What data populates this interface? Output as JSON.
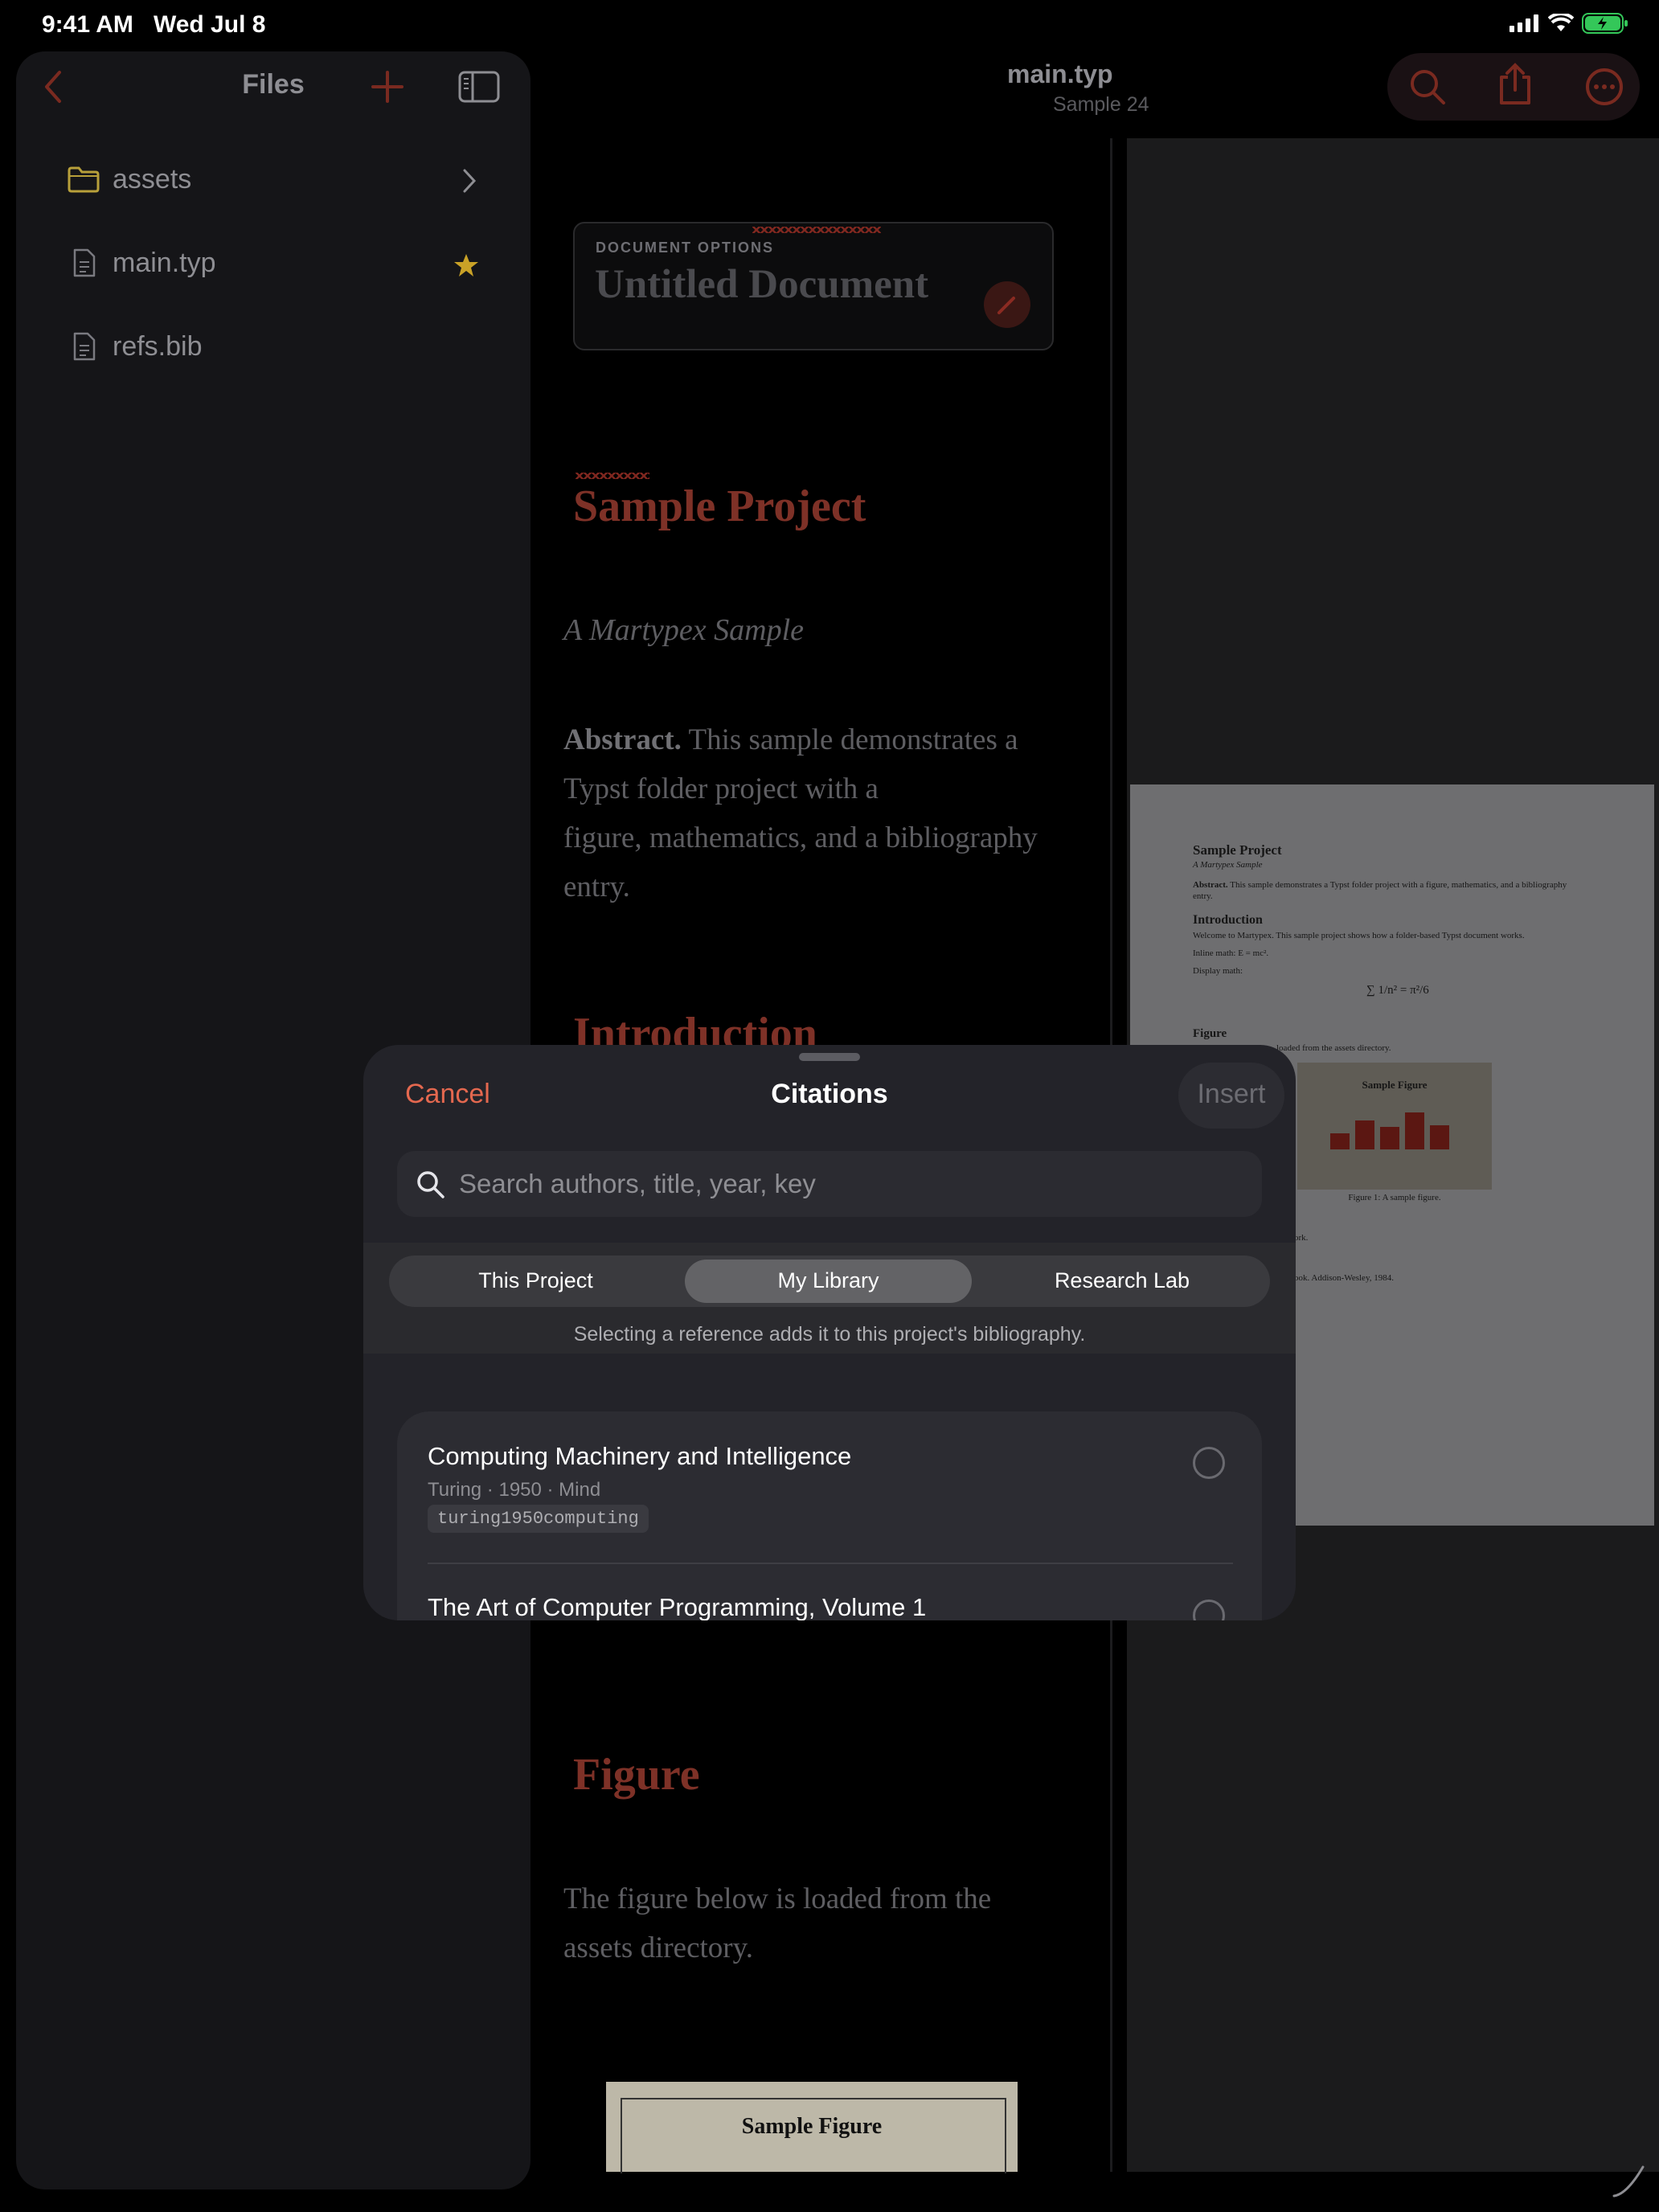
{
  "status": {
    "time": "9:41 AM",
    "date": "Wed Jul 8"
  },
  "header": {
    "title": "main.typ",
    "subtitle": "Sample 24"
  },
  "sidebar": {
    "title": "Files",
    "items": [
      {
        "label": "assets",
        "icon": "folder-icon",
        "trailing": "chevron-right-icon"
      },
      {
        "label": "main.typ",
        "icon": "document-icon",
        "trailing": "star-icon"
      },
      {
        "label": "refs.bib",
        "icon": "document-icon"
      }
    ]
  },
  "editor": {
    "options_label": "DOCUMENT OPTIONS",
    "options_title": "Untitled Document",
    "heading_project": "Sample Project",
    "subtitle": "A Martypex Sample",
    "abstract_label": "Abstract.",
    "abstract_line1": "This sample demonstrates a",
    "abstract_line2": "Typst folder project with a",
    "abstract_line3": "figure, mathematics, and a bibliography",
    "abstract_line4": "entry.",
    "heading_intro": "Introduction",
    "heading_figure": "Figure",
    "figure_line1": "The figure below is loaded from the",
    "figure_line2": "assets directory.",
    "figure_thumb_title": "Sample Figure"
  },
  "preview": {
    "title": "Sample Project",
    "subtitle": "A Martypex Sample",
    "abstract": "This sample demonstrates a Typst folder project with a figure, mathematics, and a bibliography entry.",
    "intro_heading": "Introduction",
    "intro_text": "Welcome to Martypex. This sample project shows how a folder-based Typst document works.",
    "inline_math": "Inline math: E = mc².",
    "display_math": "Display math:",
    "figure_heading": "Figure",
    "figure_text": "loaded from the assets directory.",
    "figure_box_title": "Sample Figure",
    "figure_caption": "Figure 1: A sample figure.",
    "ref_frag1": "ork.",
    "ref_frag2": "ook. Addison-Wesley, 1984."
  },
  "citations": {
    "title": "Citations",
    "cancel": "Cancel",
    "insert": "Insert",
    "search_placeholder": "Search authors, title, year, key",
    "segments": [
      "This Project",
      "My Library",
      "Research Lab"
    ],
    "active_segment": "My Library",
    "note": "Selecting a reference adds it to this project's bibliography.",
    "references": [
      {
        "title": "Computing Machinery and Intelligence",
        "meta": "Turing · 1950 · Mind",
        "key": "turing1950computing"
      },
      {
        "title": "The Art of Computer Programming, Volume 1"
      }
    ]
  },
  "colors": {
    "accent": "#e4684f",
    "heading": "#7e3127",
    "star": "#c9a227",
    "folder": "#b8a03a"
  }
}
